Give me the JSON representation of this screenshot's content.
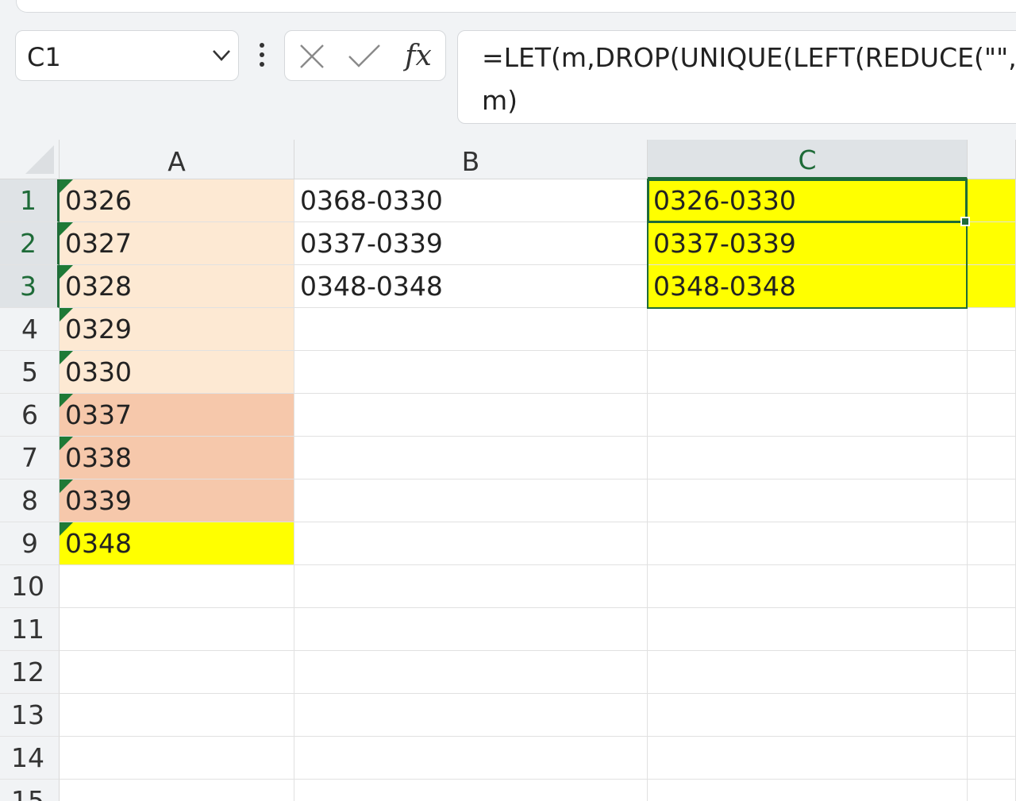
{
  "name_box": {
    "value": "C1"
  },
  "formula_bar": {
    "fx_label": "fx",
    "formula_line1": "=LET(m,DROP(UNIQUE(LEFT(REDUCE(\"\",",
    "formula_line2": "m)"
  },
  "columns": [
    {
      "label": "A"
    },
    {
      "label": "B"
    },
    {
      "label": "C"
    }
  ],
  "rows": [
    "1",
    "2",
    "3",
    "4",
    "5",
    "6",
    "7",
    "8",
    "9",
    "10",
    "11",
    "12",
    "13",
    "14",
    "15"
  ],
  "cells": {
    "A": [
      "0326",
      "0327",
      "0328",
      "0329",
      "0330",
      "0337",
      "0338",
      "0339",
      "0348"
    ],
    "B": [
      "0368-0330",
      "0337-0339",
      "0348-0348"
    ],
    "C": [
      "0326-0330",
      "0337-0339",
      "0348-0348"
    ]
  },
  "colors": {
    "fill_group1": "#fde9d3",
    "fill_group2": "#f6c8ab",
    "fill_highlight": "#ffff00",
    "selection": "#1e6b38",
    "text_number_flag": "#1e7a36"
  }
}
